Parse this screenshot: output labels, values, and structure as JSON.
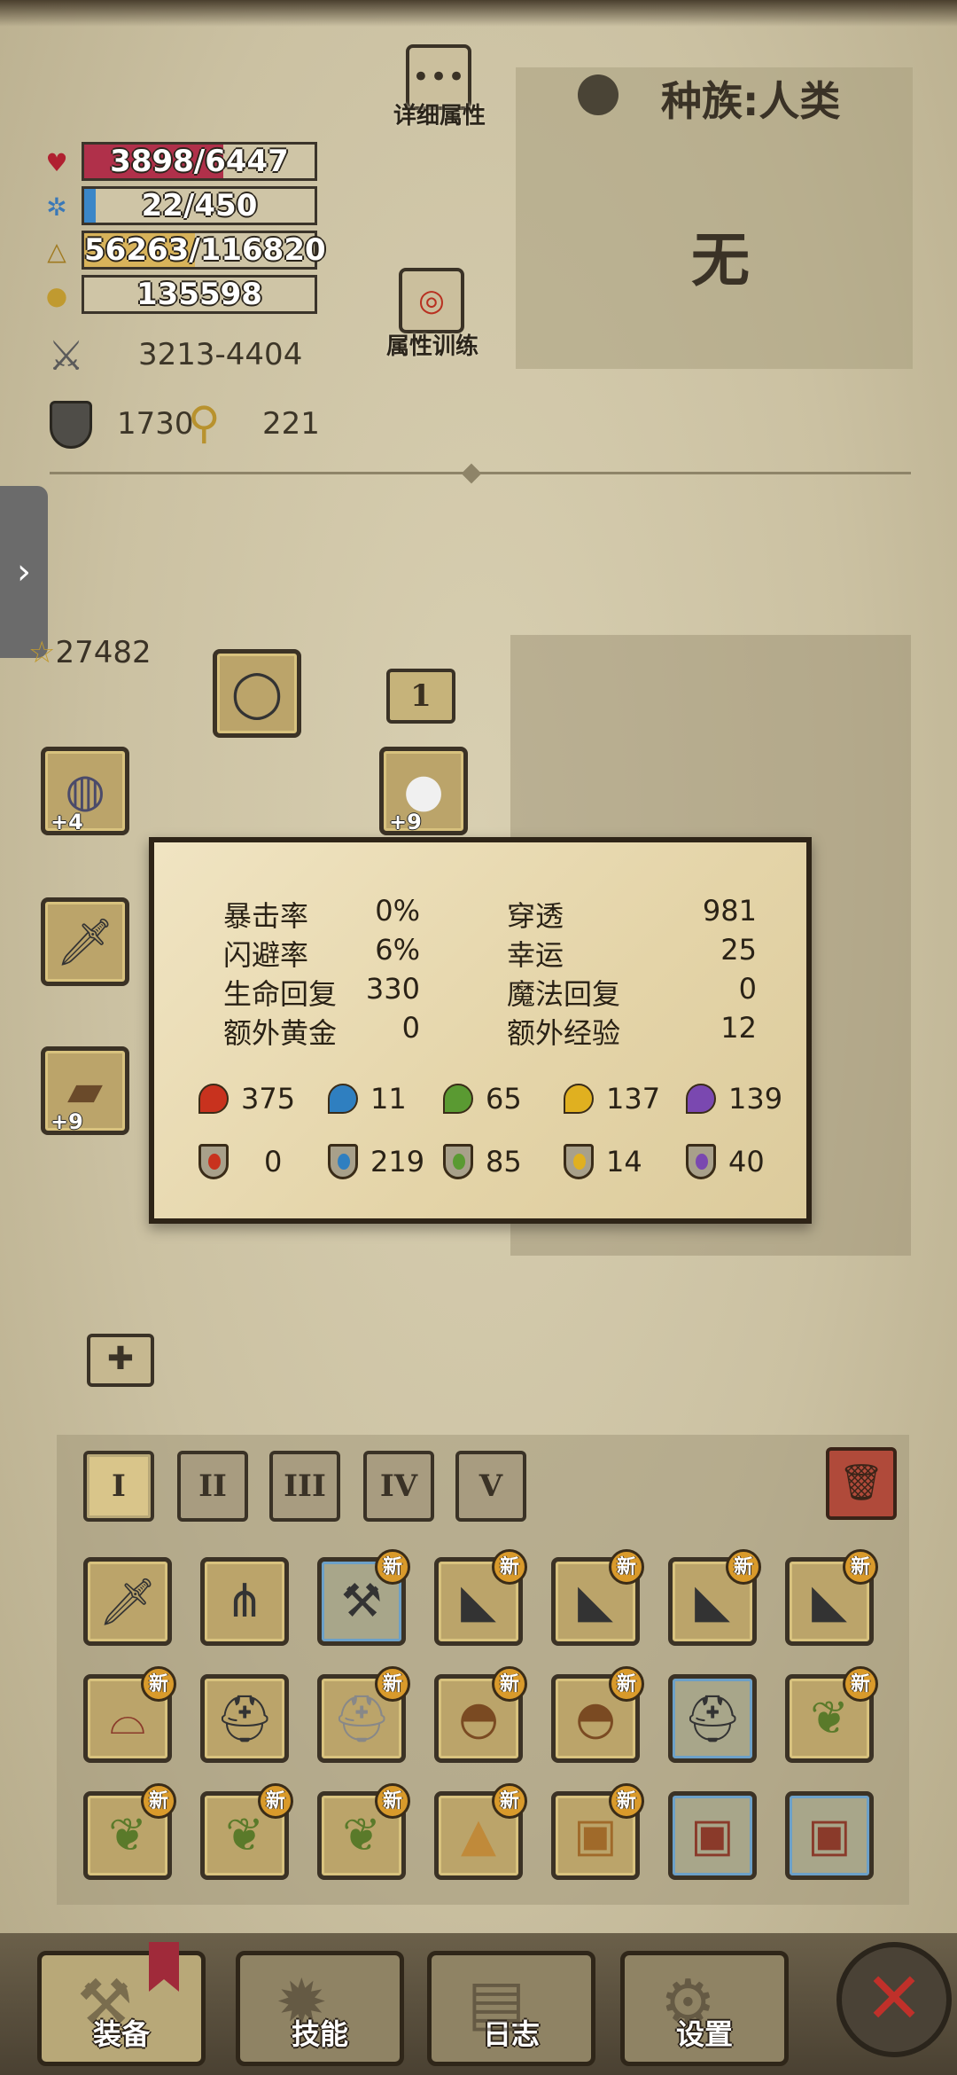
{
  "stats": {
    "hp": "3898/6447",
    "mp": "22/450",
    "exp": "56263/116820",
    "gold": "135598",
    "attack": "3213-4404",
    "defense": "1730",
    "misc": "221",
    "hp_ratio": 0.605,
    "mp_ratio": 0.049,
    "exp_ratio": 0.482
  },
  "buttons": {
    "details": "详细属性",
    "training": "属性训练"
  },
  "race": {
    "label": "种族:人类",
    "value": "无"
  },
  "score": "27482",
  "chain_count": "1",
  "equipped": {
    "ring_plus": "+4",
    "amulet_plus": "+9",
    "arm_plus": "+9"
  },
  "tooltip": {
    "rows": [
      {
        "l1": "暴击率",
        "v1": "0%",
        "l2": "穿透",
        "v2": "981"
      },
      {
        "l1": "闪避率",
        "v1": "6%",
        "l2": "幸运",
        "v2": "25"
      },
      {
        "l1": "生命回复",
        "v1": "330",
        "l2": "魔法回复",
        "v2": "0"
      },
      {
        "l1": "额外黄金",
        "v1": "0",
        "l2": "额外经验",
        "v2": "12"
      }
    ],
    "attack_elements": [
      "375",
      "11",
      "65",
      "137",
      "139"
    ],
    "resist_elements": [
      "0",
      "219",
      "85",
      "14",
      "40"
    ],
    "element_colors": [
      "#c8321e",
      "#2f7fc0",
      "#5a9a32",
      "#e0b020",
      "#7a48b0"
    ]
  },
  "tiers": [
    "I",
    "II",
    "III",
    "IV",
    "V"
  ],
  "new_tag": "新",
  "nav": {
    "equip": "装备",
    "skills": "技能",
    "log": "日志",
    "settings": "设置"
  }
}
